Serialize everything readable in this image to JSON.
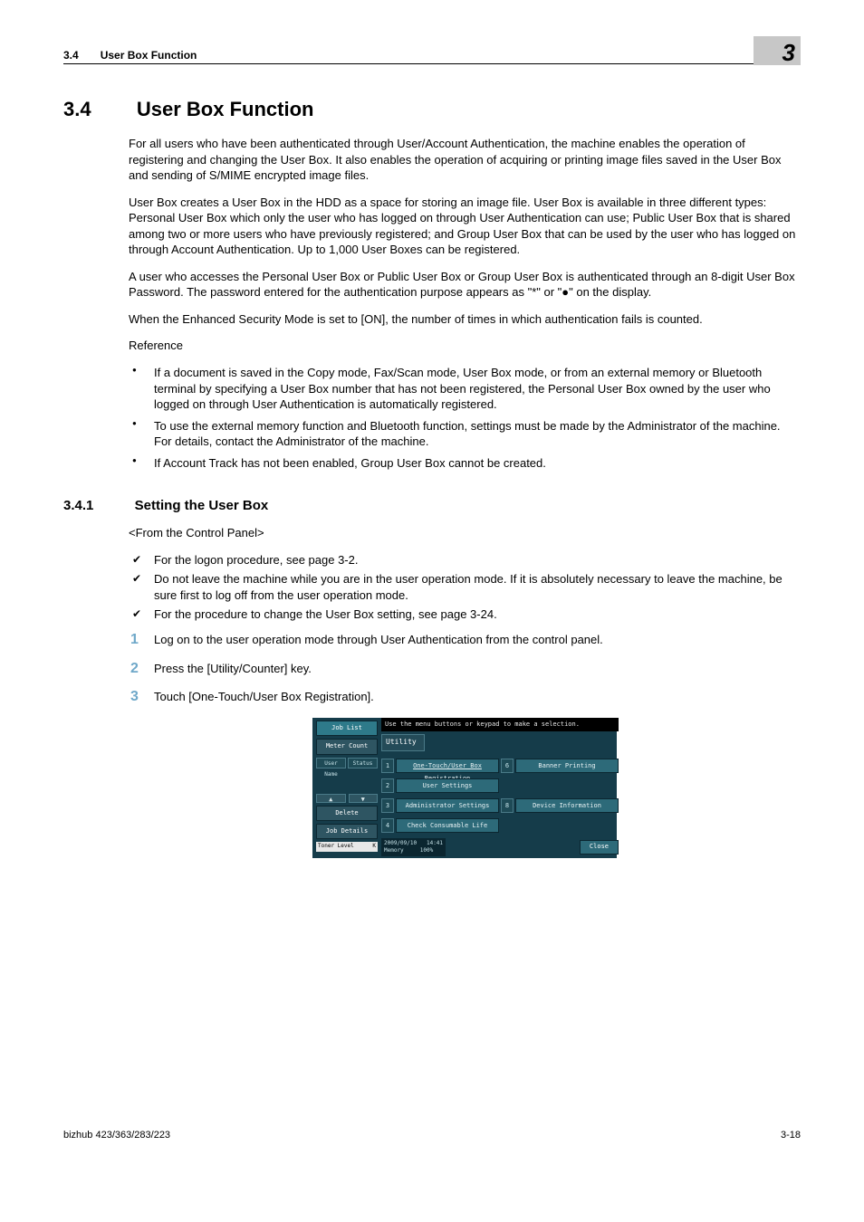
{
  "running_head": {
    "num": "3.4",
    "title": "User Box Function",
    "chapter_badge": "3"
  },
  "section": {
    "num": "3.4",
    "title": "User Box Function",
    "paras": [
      "For all users who have been authenticated through User/Account Authentication, the machine enables the operation of registering and changing the User Box. It also enables the operation of acquiring or printing image files saved in the User Box and sending of S/MIME encrypted image files.",
      "User Box creates a User Box in the HDD as a space for storing an image file. User Box is available in three different types: Personal User Box which only the user who has logged on through User Authentication can use; Public User Box that is shared among two or more users who have previously registered; and Group User Box that can be used by the user who has logged on through Account Authentication. Up to 1,000 User Boxes can be registered.",
      "A user who accesses the Personal User Box or Public User Box or Group User Box is authenticated through an 8-digit User Box Password. The password entered for the authentication purpose appears as \"*\" or \"●\" on the display.",
      "When the Enhanced Security Mode is set to [ON], the number of times in which authentication fails is counted."
    ],
    "reference_label": "Reference",
    "reference_items": [
      "If a document is saved in the Copy mode, Fax/Scan mode, User Box mode, or from an external memory or Bluetooth terminal by specifying a User Box number that has not been registered, the Personal User Box owned by the user who logged on through User Authentication is automatically registered.",
      "To use the external memory function and Bluetooth function, settings must be made by the Administrator of the machine. For details, contact the Administrator of the machine.",
      "If Account Track has not been enabled, Group User Box cannot be created."
    ]
  },
  "subsection": {
    "num": "3.4.1",
    "title": "Setting the User Box",
    "subtitle": "<From the Control Panel>",
    "preconditions": [
      "For the logon procedure, see page 3-2.",
      "Do not leave the machine while you are in the user operation mode. If it is absolutely necessary to leave the machine, be sure first to log off from the user operation mode.",
      "For the procedure to change the User Box setting, see page 3-24."
    ],
    "steps": [
      "Log on to the user operation mode through User Authentication from the control panel.",
      "Press the [Utility/Counter] key.",
      "Touch [One-Touch/User Box Registration]."
    ]
  },
  "panel": {
    "side": {
      "job_list": "Job List",
      "meter_count": "Meter Count",
      "user_name": "User\nName",
      "status": "Status",
      "delete": "Delete",
      "job_details": "Job Details",
      "toner_label": "Toner Level",
      "toner_k": "K"
    },
    "topbar": "Use the menu buttons or keypad to make a selection.",
    "utility_title": "Utility",
    "options": {
      "n1": "1",
      "o1": "One-Touch/User Box\nRegistration",
      "n2": "2",
      "o2": "User Settings",
      "n3": "3",
      "o3": "Administrator Settings",
      "n4": "4",
      "o4": "Check Consumable Life",
      "n6": "6",
      "o6": "Banner Printing",
      "n8": "8",
      "o8": "Device Information"
    },
    "timestamp_date": "2009/09/10",
    "timestamp_time": "14:41",
    "memory_label": "Memory",
    "memory_value": "100%",
    "close": "Close"
  },
  "footer": {
    "left": "bizhub 423/363/283/223",
    "right": "3-18"
  }
}
